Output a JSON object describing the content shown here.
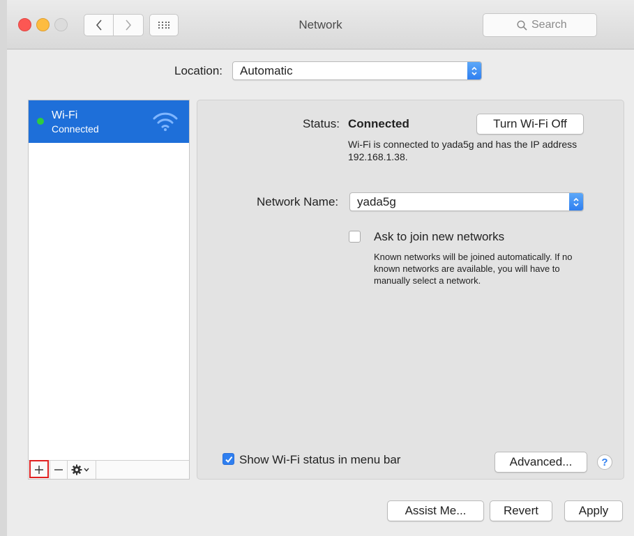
{
  "window": {
    "title": "Network",
    "search_placeholder": "Search"
  },
  "location": {
    "label": "Location:",
    "value": "Automatic"
  },
  "sidebar": {
    "items": [
      {
        "name": "Wi-Fi",
        "status": "Connected",
        "status_color": "#2ecc40",
        "icon": "wifi-icon"
      }
    ],
    "footer": {
      "add_icon": "plus-icon",
      "remove_icon": "minus-icon",
      "action_icon": "gear-icon"
    }
  },
  "main": {
    "status_label": "Status:",
    "status_value": "Connected",
    "turn_off_button": "Turn Wi-Fi Off",
    "status_description": "Wi-Fi is connected to yada5g and has the IP address 192.168.1.38.",
    "network_name_label": "Network Name:",
    "network_name_value": "yada5g",
    "ask_join_label": "Ask to join new networks",
    "ask_join_checked": false,
    "ask_join_description": "Known networks will be joined automatically. If no known networks are available, you will have to manually select a network.",
    "show_status_label": "Show Wi-Fi status in menu bar",
    "show_status_checked": true,
    "advanced_button": "Advanced...",
    "help_button": "?"
  },
  "footer_buttons": {
    "assist": "Assist Me...",
    "revert": "Revert",
    "apply": "Apply"
  },
  "colors": {
    "accent": "#2f7ff0",
    "selection": "#1e6fd9",
    "close": "#fc5753",
    "minimize": "#fdbc40"
  }
}
